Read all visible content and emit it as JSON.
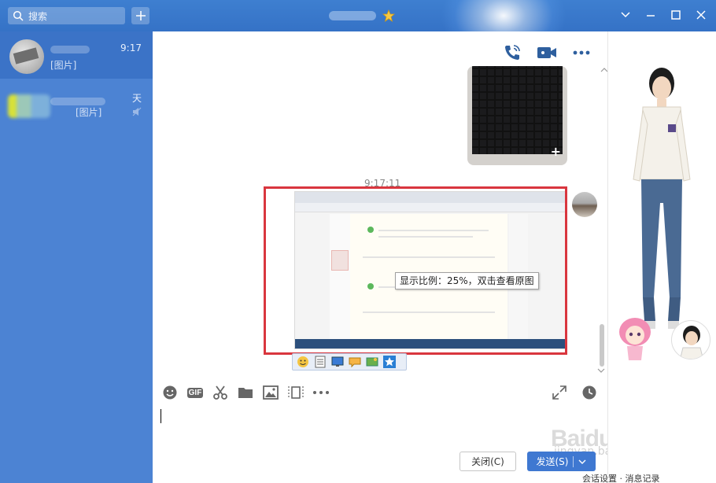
{
  "titlebar": {
    "search_placeholder": "搜索"
  },
  "conversations": [
    {
      "time": "9:17",
      "preview": "[图片]"
    },
    {
      "time": "天",
      "preview": "[图片]"
    }
  ],
  "chat": {
    "message_time": "9:17:11",
    "zoom_tooltip": "显示比例：25%，双击查看原图",
    "close_button": "关闭(C)",
    "send_button": "发送(S)"
  },
  "watermark": {
    "brand": "Baidu经验",
    "url": "jingyan.baidu.com"
  },
  "footer": {
    "text": "会话设置 · 消息记录"
  },
  "colors": {
    "titlebar": "#3e7fd0",
    "sidebar": "#4c83d3",
    "sidebar_active": "#3b73c7",
    "accent": "#3f78d1",
    "highlight_frame": "#d9363e"
  }
}
